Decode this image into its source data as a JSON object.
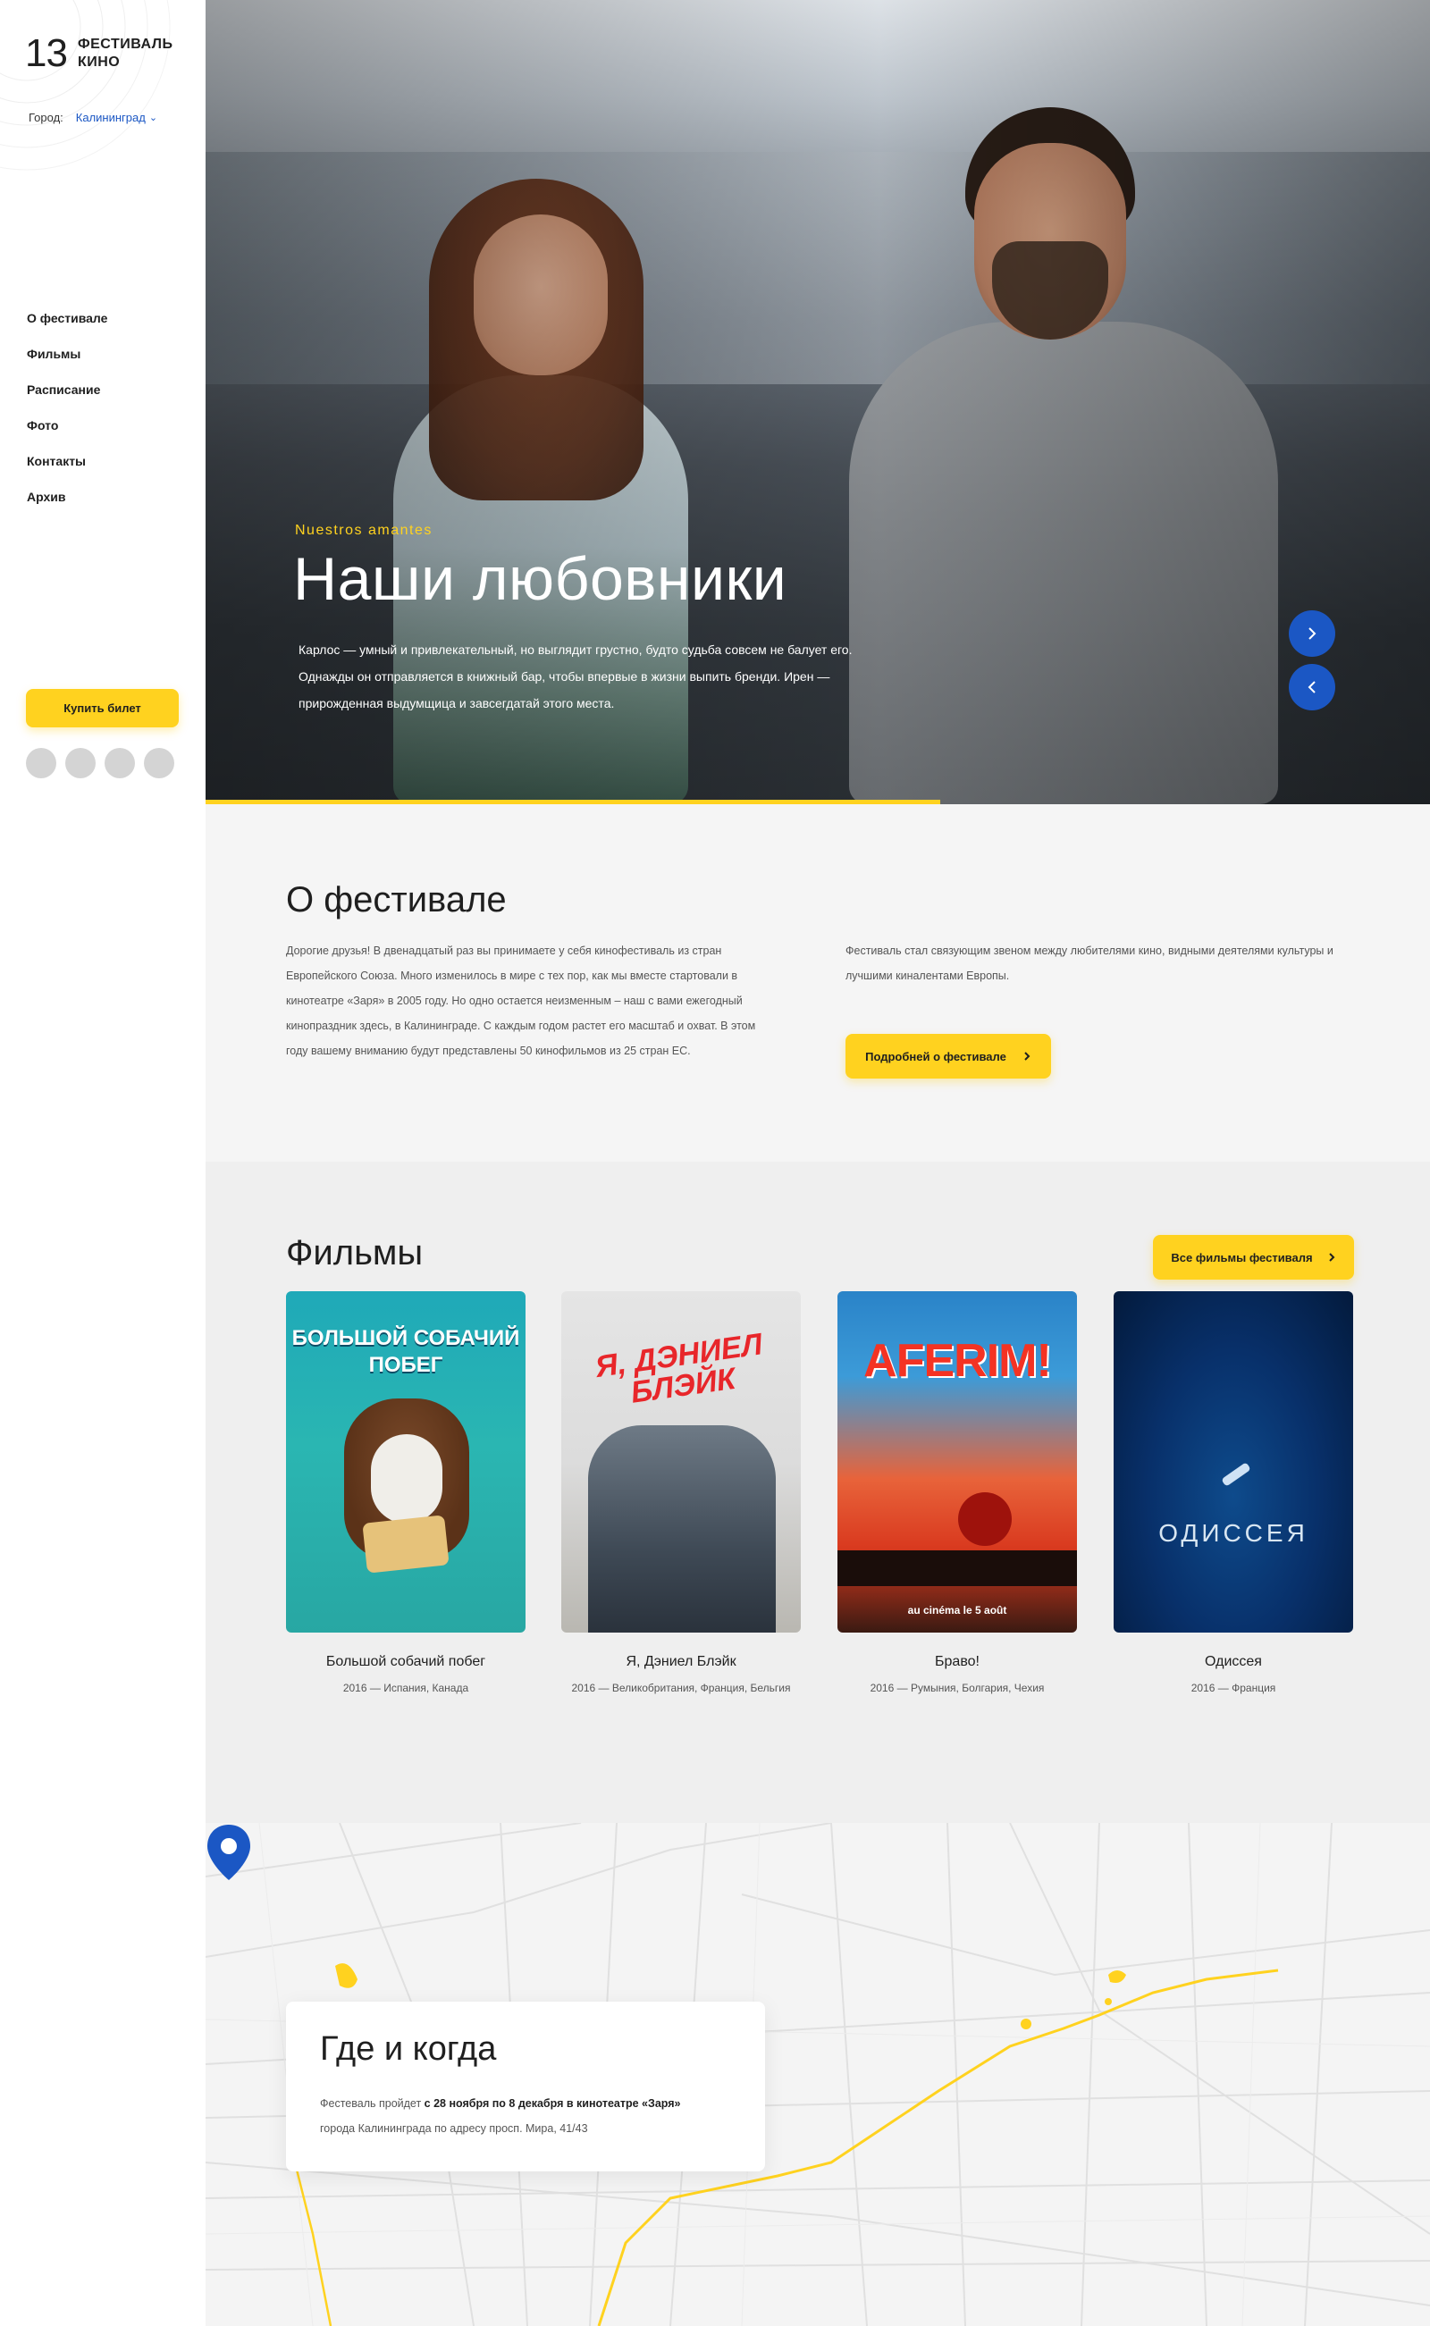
{
  "sidebar": {
    "logo_number": "13",
    "logo_line1": "Фестиваль",
    "logo_line2": "кино",
    "city_label": "Город:",
    "city_value": "Калининград",
    "nav": [
      {
        "label": "О фестивале"
      },
      {
        "label": "Фильмы"
      },
      {
        "label": "Расписание"
      },
      {
        "label": "Фото"
      },
      {
        "label": "Контакты"
      },
      {
        "label": "Архив"
      }
    ],
    "buy_ticket_label": "Купить билет"
  },
  "hero": {
    "subtitle": "Nuestros amantes",
    "title": "Наши любовники",
    "description": "Карлос — умный и привлекательный, но выглядит грустно, будто судьба совсем не балует его. Однажды он отправляется в книжный бар, чтобы впервые в жизни выпить бренди. Ирен — прирожденная выдумщица и завсегдатай этого места.",
    "next_icon": "chevron-right-icon",
    "prev_icon": "chevron-left-icon",
    "slide_progress": 0.6
  },
  "about": {
    "title": "О фестивале",
    "text_left": "Дорогие друзья! В двенадцатый раз вы принимаете у себя кинофестиваль из стран Европейского Союза. Много изменилось в мире с тех пор, как мы вместе стартовали в кинотеатре «Заря» в 2005 году. Но одно остается неизменным – наш с вами ежегодный кинопраздник здесь, в Калининграде. С каждым годом растет его масштаб и охват. В этом году вашему вниманию будут представлены 50 кинофильмов из 25 стран ЕС.",
    "text_right": "Фестиваль стал связующим звеном между любителями кино, видными деятелями культуры и лучшими киналентами Европы.",
    "button_label": "Подробней о фестивале",
    "button_icon": "chevron-right-icon"
  },
  "films": {
    "title": "Фильмы",
    "all_button_label": "Все фильмы фестиваля",
    "items": [
      {
        "title": "Большой собачий побег",
        "year": "2016",
        "countries": "Испания, Канада",
        "poster_text": "БОЛЬШОЙ СОБАЧИЙ ПОБЕГ"
      },
      {
        "title": "Я, Дэниел Блэйк",
        "year": "2016",
        "countries": "Великобритания, Франция, Бельгия",
        "poster_text": "Я, ДЭНИЕЛ БЛЭЙК"
      },
      {
        "title": "Браво!",
        "year": "2016",
        "countries": "Румыния, Болгария, Чехия",
        "poster_text": "AFERIM!",
        "poster_bottom": "au cinéma le 5 août"
      },
      {
        "title": "Одиссея",
        "year": "2016",
        "countries": "Франция",
        "poster_text": "ОДИССЕЯ"
      }
    ],
    "separator": "—"
  },
  "where": {
    "title": "Где и когда",
    "text_prefix": "Фестеваль пройдет",
    "text_bold": "с 28 ноября по 8 декабря в кинотеатре «Заря»",
    "text_suffix": "города Калининграда по адресу просп. Мира, 41/43",
    "pin_icon": "map-pin-icon"
  },
  "colors": {
    "accent": "#ffd21f",
    "blue": "#1b57c4",
    "text": "#1f1f1f"
  }
}
